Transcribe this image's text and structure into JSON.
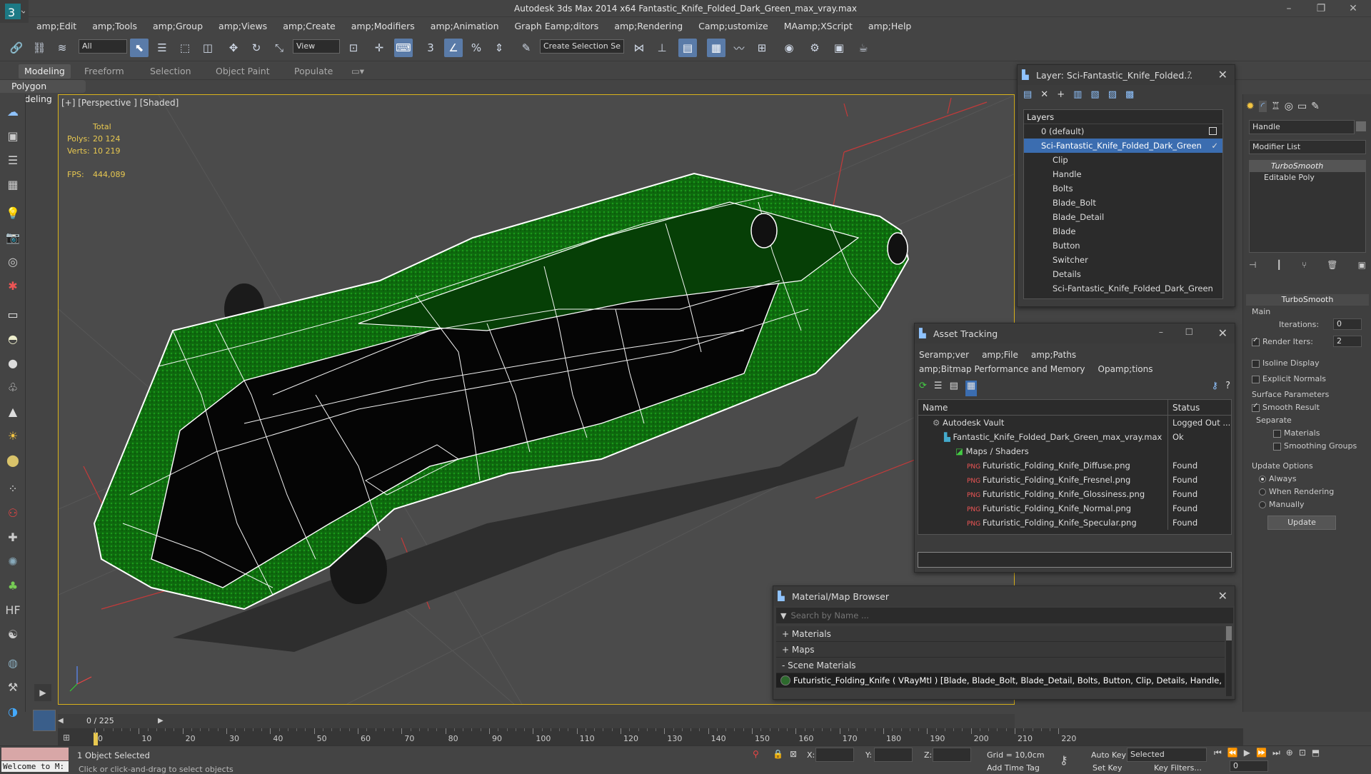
{
  "window": {
    "title": "Autodesk 3ds Max  2014 x64     Fantastic_Knife_Folded_Dark_Green_max_vray.max",
    "minimize": "–",
    "restore": "❐",
    "close": "✕"
  },
  "menu": [
    "amp;Edit",
    "amp;Tools",
    "amp;Group",
    "amp;Views",
    "amp;Create",
    "amp;Modifiers",
    "amp;Animation",
    "Graph Eamp;ditors",
    "amp;Rendering",
    "Camp;ustomize",
    "MAamp;XScript",
    "amp;Help"
  ],
  "toolbar": {
    "selection_filter": "All",
    "ref_coord": "View",
    "named_selection": "Create Selection Se"
  },
  "ribbon": {
    "tabs": [
      "Modeling",
      "Freeform",
      "Selection",
      "Object Paint",
      "Populate"
    ],
    "active_tab": "Modeling",
    "subpanel": "Polygon Modeling"
  },
  "viewport": {
    "label": "[+] [Perspective ] [Shaded]",
    "stats": {
      "header": "Total",
      "polys_label": "Polys:",
      "polys": "20 124",
      "verts_label": "Verts:",
      "verts": "10 219",
      "fps_label": "FPS:",
      "fps": "444,089"
    }
  },
  "layer_panel": {
    "title": "Layer: Sci-Fantastic_Knife_Folded...",
    "help": "?",
    "header": "Layers",
    "rows": [
      {
        "label": "0 (default)",
        "level": 0
      },
      {
        "label": "Sci-Fantastic_Knife_Folded_Dark_Green",
        "level": 0,
        "selected": true
      },
      {
        "label": "Clip",
        "level": 1
      },
      {
        "label": "Handle",
        "level": 1
      },
      {
        "label": "Bolts",
        "level": 1
      },
      {
        "label": "Blade_Bolt",
        "level": 1
      },
      {
        "label": "Blade_Detail",
        "level": 1
      },
      {
        "label": "Blade",
        "level": 1
      },
      {
        "label": "Button",
        "level": 1
      },
      {
        "label": "Switcher",
        "level": 1
      },
      {
        "label": "Details",
        "level": 1
      },
      {
        "label": "Sci-Fantastic_Knife_Folded_Dark_Green",
        "level": 1
      }
    ]
  },
  "asset_panel": {
    "title": "Asset Tracking",
    "menu": [
      "Seramp;ver",
      "amp;File",
      "amp;Paths",
      "amp;Bitmap Performance and Memory",
      "Opamp;tions"
    ],
    "col_name": "Name",
    "col_status": "Status",
    "rows": [
      {
        "name": "Autodesk Vault",
        "status": "Logged Out ...",
        "level": 0
      },
      {
        "name": "Fantastic_Knife_Folded_Dark_Green_max_vray.max",
        "status": "Ok",
        "level": 1
      },
      {
        "name": "Maps / Shaders",
        "status": "",
        "level": 2
      },
      {
        "name": "Futuristic_Folding_Knife_Diffuse.png",
        "status": "Found",
        "level": 3
      },
      {
        "name": "Futuristic_Folding_Knife_Fresnel.png",
        "status": "Found",
        "level": 3
      },
      {
        "name": "Futuristic_Folding_Knife_Glossiness.png",
        "status": "Found",
        "level": 3
      },
      {
        "name": "Futuristic_Folding_Knife_Normal.png",
        "status": "Found",
        "level": 3
      },
      {
        "name": "Futuristic_Folding_Knife_Specular.png",
        "status": "Found",
        "level": 3
      }
    ]
  },
  "material_browser": {
    "title": "Material/Map Browser",
    "search_placeholder": "Search by Name ...",
    "sections": [
      "+ Materials",
      "+ Maps",
      "- Scene Materials"
    ],
    "scene_material": "Futuristic_Folding_Knife  ( VRayMtl ) [Blade, Blade_Bolt, Blade_Detail, Bolts, Button, Clip, Details, Handle, Switcher]"
  },
  "command_panel": {
    "object_name": "Handle",
    "modifier_list": "Modifier List",
    "stack": [
      "TurboSmooth",
      "Editable Poly"
    ],
    "rollout_title": "TurboSmooth",
    "main_label": "Main",
    "iterations_label": "Iterations:",
    "iterations": "0",
    "render_iters_label": "Render Iters:",
    "render_iters": "2",
    "isoline": "Isoline Display",
    "explicit_normals": "Explicit Normals",
    "surface_params": "Surface Parameters",
    "smooth_result": "Smooth Result",
    "separate": "Separate",
    "materials": "Materials",
    "smoothing_groups": "Smoothing Groups",
    "update_options": "Update Options",
    "always": "Always",
    "when_rendering": "When Rendering",
    "manually": "Manually",
    "update_btn": "Update"
  },
  "timeline": {
    "frame": "0 / 225",
    "ticks": [
      "0",
      "10",
      "20",
      "30",
      "40",
      "50",
      "60",
      "70",
      "80",
      "90",
      "100",
      "110",
      "120",
      "130",
      "140",
      "150",
      "160",
      "170",
      "180",
      "190",
      "200",
      "210",
      "220"
    ]
  },
  "status": {
    "welcome": "Welcome to M:",
    "selected": "1 Object Selected",
    "prompt": "Click or click-and-drag to select objects",
    "x_label": "X:",
    "y_label": "Y:",
    "z_label": "Z:",
    "grid": "Grid = 10,0cm",
    "auto_key": "Auto Key",
    "set_key": "Set Key",
    "key_mode": "Selected",
    "key_filters": "Key Filters...",
    "add_time_tag": "Add Time Tag",
    "frame_field": "0"
  }
}
